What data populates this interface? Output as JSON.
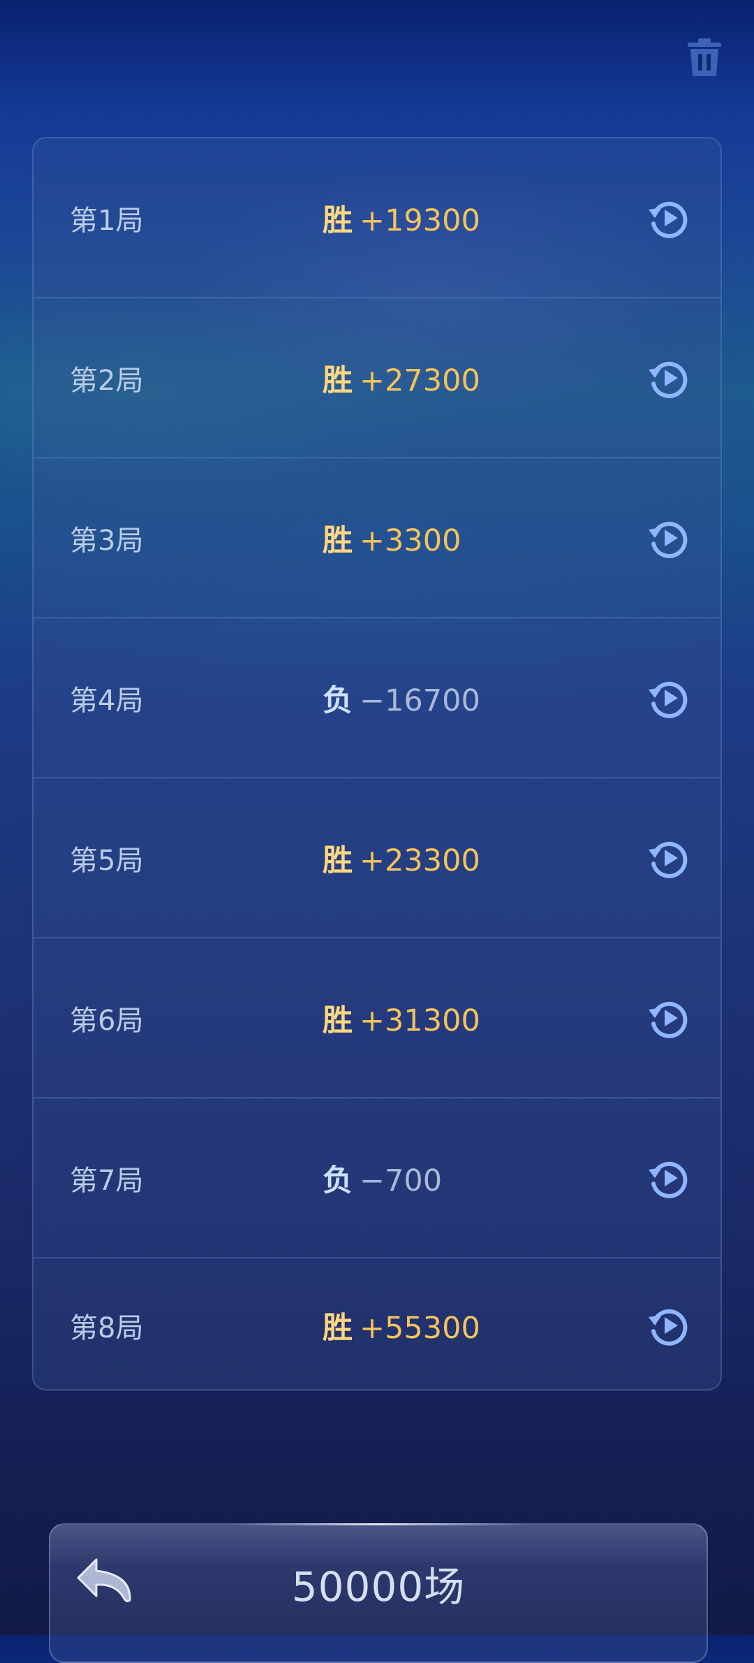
{
  "header": {
    "trash_icon": "trash-icon"
  },
  "colors": {
    "win": "#f4c35a",
    "loss": "#a9b9d6",
    "replay_icon": "#8fb6ff"
  },
  "rounds": [
    {
      "label": "第1局",
      "outcome": "胜",
      "score": "+19300",
      "is_win": true,
      "icon": "replay-icon"
    },
    {
      "label": "第2局",
      "outcome": "胜",
      "score": "+27300",
      "is_win": true,
      "icon": "replay-icon"
    },
    {
      "label": "第3局",
      "outcome": "胜",
      "score": "+3300",
      "is_win": true,
      "icon": "replay-icon"
    },
    {
      "label": "第4局",
      "outcome": "负",
      "score": "−16700",
      "is_win": false,
      "icon": "replay-icon"
    },
    {
      "label": "第5局",
      "outcome": "胜",
      "score": "+23300",
      "is_win": true,
      "icon": "replay-icon"
    },
    {
      "label": "第6局",
      "outcome": "胜",
      "score": "+31300",
      "is_win": true,
      "icon": "replay-icon"
    },
    {
      "label": "第7局",
      "outcome": "负",
      "score": "−700",
      "is_win": false,
      "icon": "replay-icon"
    },
    {
      "label": "第8局",
      "outcome": "胜",
      "score": "+55300",
      "is_win": true,
      "icon": "replay-icon"
    }
  ],
  "footer": {
    "back_icon": "back-arrow-icon",
    "title": "50000场"
  }
}
